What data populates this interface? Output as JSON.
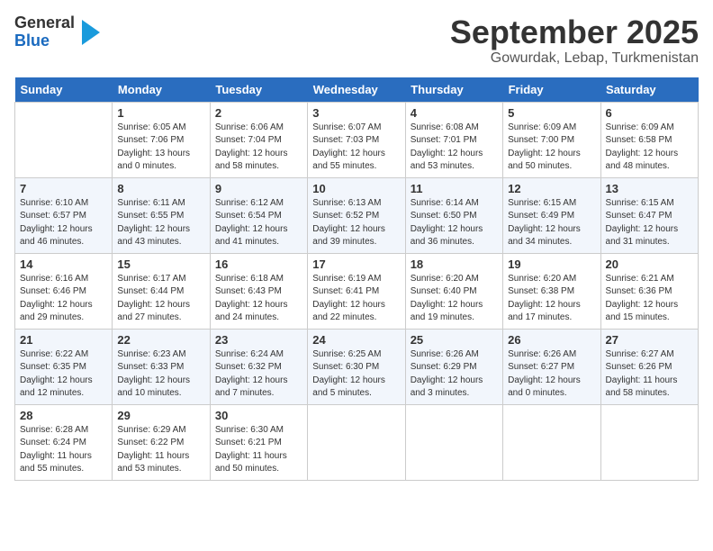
{
  "header": {
    "logo_line1": "General",
    "logo_line2": "Blue",
    "month": "September 2025",
    "location": "Gowurdak, Lebap, Turkmenistan"
  },
  "weekdays": [
    "Sunday",
    "Monday",
    "Tuesday",
    "Wednesday",
    "Thursday",
    "Friday",
    "Saturday"
  ],
  "weeks": [
    [
      {
        "day": "",
        "sunrise": "",
        "sunset": "",
        "daylight": ""
      },
      {
        "day": "1",
        "sunrise": "Sunrise: 6:05 AM",
        "sunset": "Sunset: 7:06 PM",
        "daylight": "Daylight: 13 hours and 0 minutes."
      },
      {
        "day": "2",
        "sunrise": "Sunrise: 6:06 AM",
        "sunset": "Sunset: 7:04 PM",
        "daylight": "Daylight: 12 hours and 58 minutes."
      },
      {
        "day": "3",
        "sunrise": "Sunrise: 6:07 AM",
        "sunset": "Sunset: 7:03 PM",
        "daylight": "Daylight: 12 hours and 55 minutes."
      },
      {
        "day": "4",
        "sunrise": "Sunrise: 6:08 AM",
        "sunset": "Sunset: 7:01 PM",
        "daylight": "Daylight: 12 hours and 53 minutes."
      },
      {
        "day": "5",
        "sunrise": "Sunrise: 6:09 AM",
        "sunset": "Sunset: 7:00 PM",
        "daylight": "Daylight: 12 hours and 50 minutes."
      },
      {
        "day": "6",
        "sunrise": "Sunrise: 6:09 AM",
        "sunset": "Sunset: 6:58 PM",
        "daylight": "Daylight: 12 hours and 48 minutes."
      }
    ],
    [
      {
        "day": "7",
        "sunrise": "Sunrise: 6:10 AM",
        "sunset": "Sunset: 6:57 PM",
        "daylight": "Daylight: 12 hours and 46 minutes."
      },
      {
        "day": "8",
        "sunrise": "Sunrise: 6:11 AM",
        "sunset": "Sunset: 6:55 PM",
        "daylight": "Daylight: 12 hours and 43 minutes."
      },
      {
        "day": "9",
        "sunrise": "Sunrise: 6:12 AM",
        "sunset": "Sunset: 6:54 PM",
        "daylight": "Daylight: 12 hours and 41 minutes."
      },
      {
        "day": "10",
        "sunrise": "Sunrise: 6:13 AM",
        "sunset": "Sunset: 6:52 PM",
        "daylight": "Daylight: 12 hours and 39 minutes."
      },
      {
        "day": "11",
        "sunrise": "Sunrise: 6:14 AM",
        "sunset": "Sunset: 6:50 PM",
        "daylight": "Daylight: 12 hours and 36 minutes."
      },
      {
        "day": "12",
        "sunrise": "Sunrise: 6:15 AM",
        "sunset": "Sunset: 6:49 PM",
        "daylight": "Daylight: 12 hours and 34 minutes."
      },
      {
        "day": "13",
        "sunrise": "Sunrise: 6:15 AM",
        "sunset": "Sunset: 6:47 PM",
        "daylight": "Daylight: 12 hours and 31 minutes."
      }
    ],
    [
      {
        "day": "14",
        "sunrise": "Sunrise: 6:16 AM",
        "sunset": "Sunset: 6:46 PM",
        "daylight": "Daylight: 12 hours and 29 minutes."
      },
      {
        "day": "15",
        "sunrise": "Sunrise: 6:17 AM",
        "sunset": "Sunset: 6:44 PM",
        "daylight": "Daylight: 12 hours and 27 minutes."
      },
      {
        "day": "16",
        "sunrise": "Sunrise: 6:18 AM",
        "sunset": "Sunset: 6:43 PM",
        "daylight": "Daylight: 12 hours and 24 minutes."
      },
      {
        "day": "17",
        "sunrise": "Sunrise: 6:19 AM",
        "sunset": "Sunset: 6:41 PM",
        "daylight": "Daylight: 12 hours and 22 minutes."
      },
      {
        "day": "18",
        "sunrise": "Sunrise: 6:20 AM",
        "sunset": "Sunset: 6:40 PM",
        "daylight": "Daylight: 12 hours and 19 minutes."
      },
      {
        "day": "19",
        "sunrise": "Sunrise: 6:20 AM",
        "sunset": "Sunset: 6:38 PM",
        "daylight": "Daylight: 12 hours and 17 minutes."
      },
      {
        "day": "20",
        "sunrise": "Sunrise: 6:21 AM",
        "sunset": "Sunset: 6:36 PM",
        "daylight": "Daylight: 12 hours and 15 minutes."
      }
    ],
    [
      {
        "day": "21",
        "sunrise": "Sunrise: 6:22 AM",
        "sunset": "Sunset: 6:35 PM",
        "daylight": "Daylight: 12 hours and 12 minutes."
      },
      {
        "day": "22",
        "sunrise": "Sunrise: 6:23 AM",
        "sunset": "Sunset: 6:33 PM",
        "daylight": "Daylight: 12 hours and 10 minutes."
      },
      {
        "day": "23",
        "sunrise": "Sunrise: 6:24 AM",
        "sunset": "Sunset: 6:32 PM",
        "daylight": "Daylight: 12 hours and 7 minutes."
      },
      {
        "day": "24",
        "sunrise": "Sunrise: 6:25 AM",
        "sunset": "Sunset: 6:30 PM",
        "daylight": "Daylight: 12 hours and 5 minutes."
      },
      {
        "day": "25",
        "sunrise": "Sunrise: 6:26 AM",
        "sunset": "Sunset: 6:29 PM",
        "daylight": "Daylight: 12 hours and 3 minutes."
      },
      {
        "day": "26",
        "sunrise": "Sunrise: 6:26 AM",
        "sunset": "Sunset: 6:27 PM",
        "daylight": "Daylight: 12 hours and 0 minutes."
      },
      {
        "day": "27",
        "sunrise": "Sunrise: 6:27 AM",
        "sunset": "Sunset: 6:26 PM",
        "daylight": "Daylight: 11 hours and 58 minutes."
      }
    ],
    [
      {
        "day": "28",
        "sunrise": "Sunrise: 6:28 AM",
        "sunset": "Sunset: 6:24 PM",
        "daylight": "Daylight: 11 hours and 55 minutes."
      },
      {
        "day": "29",
        "sunrise": "Sunrise: 6:29 AM",
        "sunset": "Sunset: 6:22 PM",
        "daylight": "Daylight: 11 hours and 53 minutes."
      },
      {
        "day": "30",
        "sunrise": "Sunrise: 6:30 AM",
        "sunset": "Sunset: 6:21 PM",
        "daylight": "Daylight: 11 hours and 50 minutes."
      },
      {
        "day": "",
        "sunrise": "",
        "sunset": "",
        "daylight": ""
      },
      {
        "day": "",
        "sunrise": "",
        "sunset": "",
        "daylight": ""
      },
      {
        "day": "",
        "sunrise": "",
        "sunset": "",
        "daylight": ""
      },
      {
        "day": "",
        "sunrise": "",
        "sunset": "",
        "daylight": ""
      }
    ]
  ]
}
